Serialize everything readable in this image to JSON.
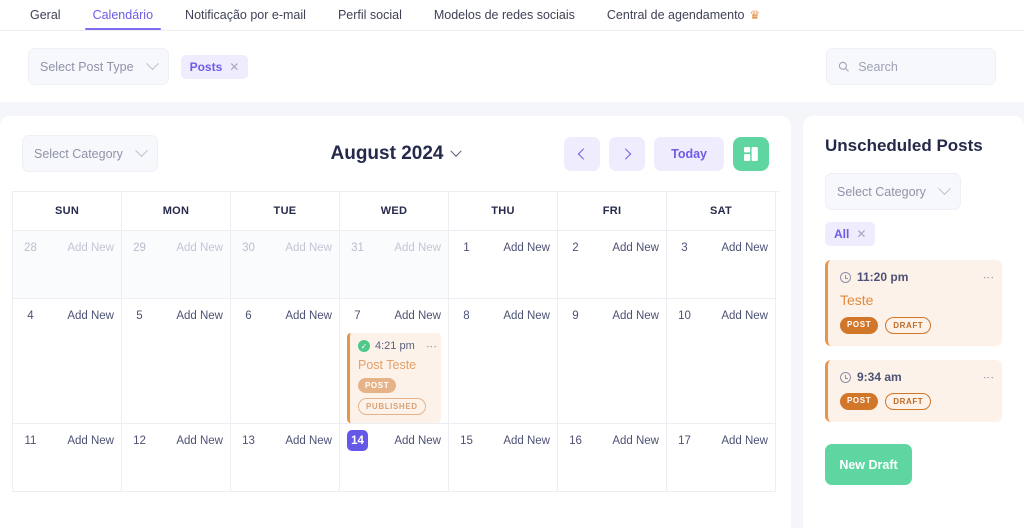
{
  "nav": {
    "tabs": [
      {
        "label": "Geral",
        "active": false
      },
      {
        "label": "Calendário",
        "active": true
      },
      {
        "label": "Notificação por e-mail",
        "active": false
      },
      {
        "label": "Perfil social",
        "active": false
      },
      {
        "label": "Modelos de redes sociais",
        "active": false
      },
      {
        "label": "Central de agendamento",
        "active": false,
        "icon": "crown-icon",
        "icon_glyph": "♛"
      }
    ]
  },
  "filterbar": {
    "post_type_select": "Select Post Type",
    "chip_label": "Posts",
    "chip_close": "✕",
    "search_placeholder": "Search",
    "search_value": "",
    "search_icon": "search-icon"
  },
  "calendar": {
    "category_select": "Select Category",
    "month_title": "August 2024",
    "prev_label": "‹",
    "next_label": "›",
    "today_label": "Today",
    "view_toggle_icon": "layout-grid-icon",
    "dow": [
      "SUN",
      "MON",
      "TUE",
      "WED",
      "THU",
      "FRI",
      "SAT"
    ],
    "add_new_label": "Add New",
    "today_date": 14,
    "weeks": [
      [
        {
          "num": "28",
          "other": true
        },
        {
          "num": "29",
          "other": true
        },
        {
          "num": "30",
          "other": true
        },
        {
          "num": "31",
          "other": true
        },
        {
          "num": "1",
          "other": false
        },
        {
          "num": "2",
          "other": false
        },
        {
          "num": "3",
          "other": false
        }
      ],
      [
        {
          "num": "4",
          "other": false
        },
        {
          "num": "5",
          "other": false
        },
        {
          "num": "6",
          "other": false
        },
        {
          "num": "7",
          "other": false,
          "event": {
            "time": "4:21 pm",
            "title": "Post Teste",
            "status_icon": "check-circle-icon",
            "menu_icon": "kebab-menu-icon",
            "badges": [
              {
                "text": "POST",
                "style": "solid"
              },
              {
                "text": "PUBLISHED",
                "style": "outline"
              }
            ]
          }
        },
        {
          "num": "8",
          "other": false
        },
        {
          "num": "9",
          "other": false
        },
        {
          "num": "10",
          "other": false
        }
      ],
      [
        {
          "num": "11",
          "other": false
        },
        {
          "num": "12",
          "other": false
        },
        {
          "num": "13",
          "other": false
        },
        {
          "num": "14",
          "other": false,
          "today": true
        },
        {
          "num": "15",
          "other": false
        },
        {
          "num": "16",
          "other": false
        },
        {
          "num": "17",
          "other": false
        }
      ]
    ]
  },
  "sidebar": {
    "title": "Unscheduled Posts",
    "category_select": "Select Category",
    "chip_label": "All",
    "chip_close": "✕",
    "cards": [
      {
        "time": "11:20 pm",
        "title": "Teste",
        "clock_icon": "clock-icon",
        "menu_icon": "kebab-menu-icon",
        "badges": [
          {
            "text": "POST",
            "style": "solid"
          },
          {
            "text": "DRAFT",
            "style": "outline"
          }
        ]
      },
      {
        "time": "9:34 am",
        "title": "",
        "clock_icon": "clock-icon",
        "menu_icon": "kebab-menu-icon",
        "badges": [
          {
            "text": "POST",
            "style": "solid"
          },
          {
            "text": "DRAFT",
            "style": "outline"
          }
        ]
      }
    ],
    "new_draft_label": "New Draft"
  },
  "colors": {
    "accent_purple": "#6c5ce7",
    "today_purple": "#6558e8",
    "green": "#5fd6a1",
    "orange_accent": "#e8944a",
    "orange_bg": "#fdf2e9",
    "page_bg": "#f5f6fa"
  }
}
